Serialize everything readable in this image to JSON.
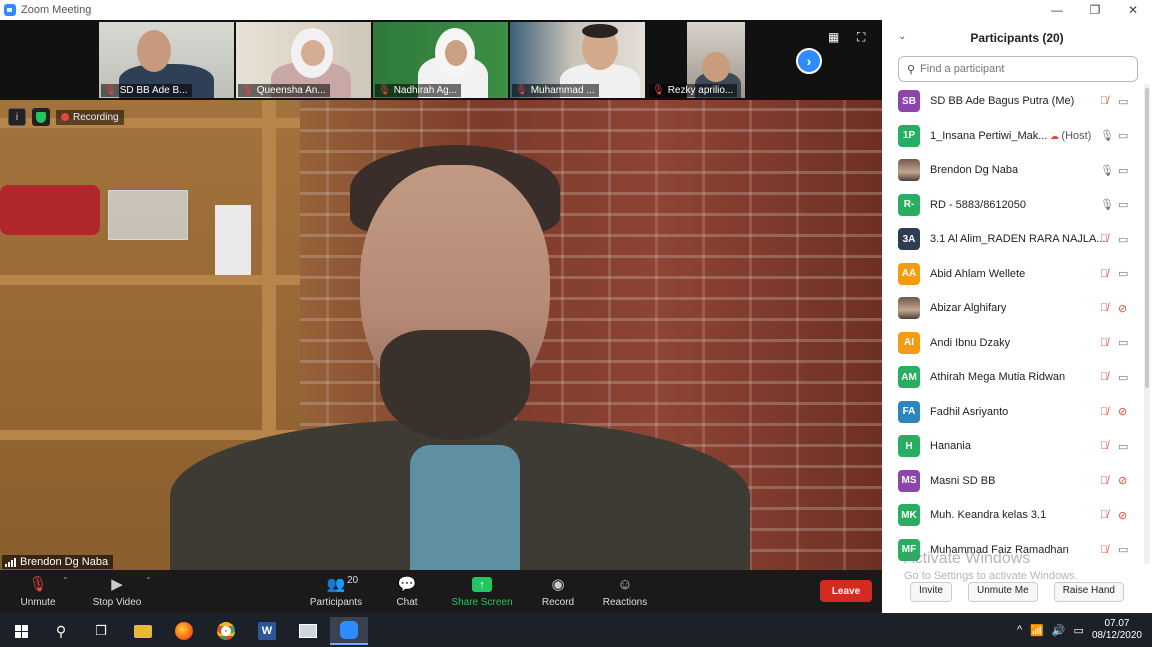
{
  "window": {
    "title": "Zoom Meeting",
    "minimize": "—",
    "maximize": "❐",
    "close": "✕"
  },
  "thumbnails": [
    {
      "name": "SD BB Ade B..."
    },
    {
      "name": "Queensha An..."
    },
    {
      "name": "Nadhirah Ag..."
    },
    {
      "name": "Muhammad ..."
    },
    {
      "name": "Rezky aprilio..."
    }
  ],
  "video": {
    "recording_label": "Recording",
    "speaker_name": "Brendon Dg Naba"
  },
  "toolbar": {
    "unmute": "Unmute",
    "stop_video": "Stop Video",
    "participants": "Participants",
    "participants_count": "20",
    "chat": "Chat",
    "share_screen": "Share Screen",
    "record": "Record",
    "reactions": "Reactions",
    "leave": "Leave"
  },
  "panel": {
    "title": "Participants (20)",
    "search_placeholder": "Find a participant",
    "participants": [
      {
        "initials": "SB",
        "name": "SD BB Ade Bagus Putra (Me)",
        "color": "#8e44ad",
        "mic": "muted",
        "cam": "on"
      },
      {
        "initials": "1P",
        "name": "1_Insana Pertiwi_Mak...",
        "tag": "(Host)",
        "color": "#27ae60",
        "mic": "on",
        "cam": "on",
        "cloud": true
      },
      {
        "initials": "",
        "name": "Brendon Dg Naba",
        "color": "",
        "photo": true,
        "mic": "on",
        "cam": "on"
      },
      {
        "initials": "R-",
        "name": "RD - 5883/8612050",
        "color": "#27ae60",
        "mic": "on",
        "cam": "on"
      },
      {
        "initials": "3A",
        "name": "3.1 Al Alim_RADEN RARA NAJLA...",
        "color": "#2c3e50",
        "mic": "muted",
        "cam": "on"
      },
      {
        "initials": "AA",
        "name": "Abid Ahlam Wellete",
        "color": "#f39c12",
        "mic": "muted",
        "cam": "on"
      },
      {
        "initials": "",
        "name": "Abizar Alghifary",
        "color": "",
        "photo": true,
        "mic": "muted",
        "cam": "off"
      },
      {
        "initials": "AI",
        "name": "Andi Ibnu Dzaky",
        "color": "#f39c12",
        "mic": "muted",
        "cam": "on"
      },
      {
        "initials": "AM",
        "name": "Athirah Mega Mutia Ridwan",
        "color": "#27ae60",
        "mic": "muted",
        "cam": "on"
      },
      {
        "initials": "FA",
        "name": "Fadhil Asriyanto",
        "color": "#2e86c1",
        "mic": "muted",
        "cam": "off"
      },
      {
        "initials": "H",
        "name": "Hanania",
        "color": "#27ae60",
        "mic": "muted",
        "cam": "on"
      },
      {
        "initials": "MS",
        "name": "Masni SD BB",
        "color": "#8e44ad",
        "mic": "muted",
        "cam": "off"
      },
      {
        "initials": "MK",
        "name": "Muh. Keandra kelas 3.1",
        "color": "#27ae60",
        "mic": "muted",
        "cam": "off"
      },
      {
        "initials": "MF",
        "name": "Muhammad Faiz Ramadhan",
        "color": "#27ae60",
        "mic": "muted",
        "cam": "on"
      }
    ],
    "activate_line1": "Activate Windows",
    "activate_line2": "Go to Settings to activate Windows.",
    "invite": "Invite",
    "unmute_me": "Unmute Me",
    "raise_hand": "Raise Hand"
  },
  "taskbar": {
    "time": "07.07",
    "date": "08/12/2020"
  }
}
